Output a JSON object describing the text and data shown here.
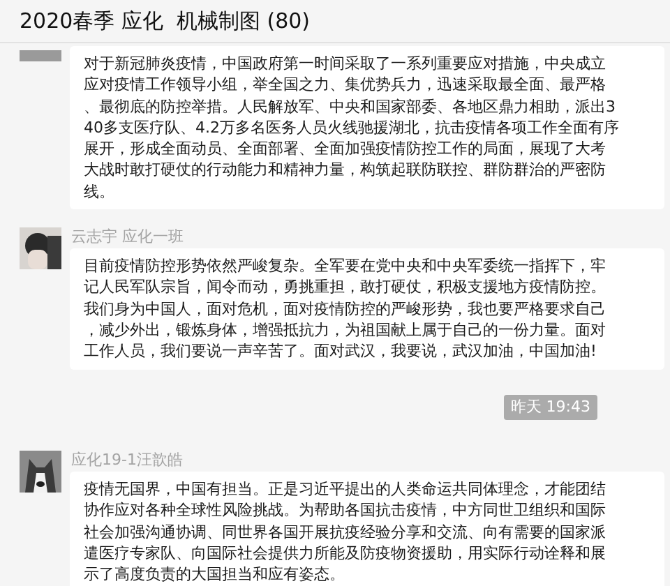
{
  "window": {
    "title": "2020春季 应化  机械制图 (80)"
  },
  "messages": [
    {
      "kind": "message",
      "lines": [
        "对于新冠肺炎疫情，中国政府第一时间采取了一系列重要应对措施，中央成立",
        "应对疫情工作领导小组，举全国之力、集优势兵力，迅速采取最全面、最严格",
        "、最彻底的防控举措。人民解放军、中央和国家部委、各地区鼎力相助，派出3",
        "40多支医疗队、4.2万多名医务人员火线驰援湖北，抗击疫情各项工作全面有序",
        "展开，形成全面动员、全面部署、全面加强疫情防控工作的局面，展现了大考",
        "大战时敢打硬仗的行动能力和精神力量，构筑起联防联控、群防群治的严密防",
        "线。"
      ]
    },
    {
      "kind": "message",
      "sender": "云志宇 应化一班",
      "lines": [
        "目前疫情防控形势依然严峻复杂。全军要在党中央和中央军委统一指挥下，牢",
        "记人民军队宗旨，闻令而动，勇挑重担，敢打硬仗，积极支援地方疫情防控。",
        "我们身为中国人，面对危机，面对疫情防控的严峻形势，我也要严格要求自己",
        "，减少外出，锻炼身体，增强抵抗力，为祖国献上属于自己的一份力量。面对",
        "工作人员，我们要说一声辛苦了。面对武汉，我要说，武汉加油，中国加油!"
      ]
    },
    {
      "kind": "time",
      "text": "昨天 19:43"
    },
    {
      "kind": "message",
      "sender": "应化19-1汪歆皓",
      "lines": [
        "疫情无国界，中国有担当。正是习近平提出的人类命运共同体理念，才能团结",
        "协作应对各种全球性风险挑战。为帮助各国抗击疫情，中方同世卫组织和国际",
        "社会加强沟通协调、同世界各国开展抗疫经验分享和交流、向有需要的国家派",
        "遣医疗专家队、向国际社会提供力所能及防疫物资援助，用实际行动诠释和展",
        "示了高度负责的大国担当和应有姿态。"
      ]
    }
  ]
}
